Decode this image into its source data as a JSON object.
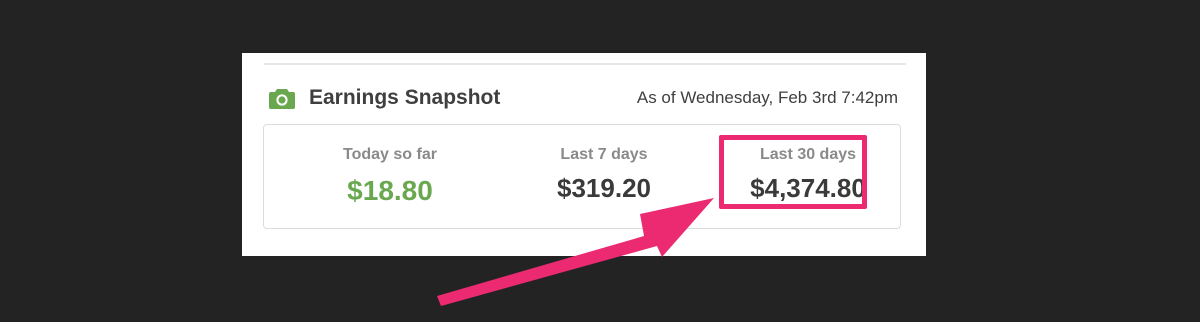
{
  "colors": {
    "background": "#232323",
    "card": "#ffffff",
    "accent_green": "#6aa84f",
    "highlight_pink": "#ec2a72",
    "text_dark": "#3a3a3a",
    "text_muted": "#8a8a8a"
  },
  "header": {
    "icon": "camera-icon",
    "title": "Earnings Snapshot",
    "timestamp": "As of Wednesday, Feb 3rd 7:42pm"
  },
  "stats": {
    "today": {
      "label": "Today so far",
      "value": "$18.80"
    },
    "week": {
      "label": "Last 7 days",
      "value": "$319.20"
    },
    "month": {
      "label": "Last 30 days",
      "value": "$4,374.80"
    }
  },
  "annotation": {
    "highlighted": "month",
    "arrow_icon": "arrow-icon"
  }
}
